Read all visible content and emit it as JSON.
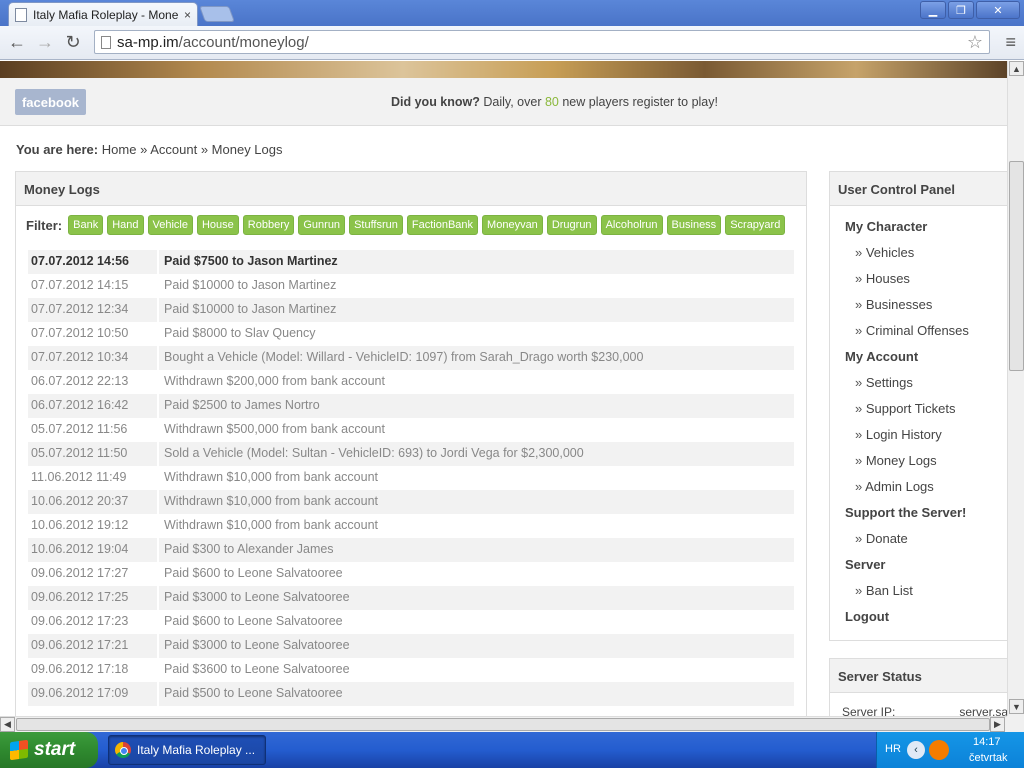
{
  "browser": {
    "tab_title": "Italy Mafia Roleplay - Money",
    "tab_close": "×",
    "url_host": "sa-mp.im",
    "url_path": "/account/moneylog/"
  },
  "page": {
    "facebook_label": "facebook",
    "did_you_know_label": "Did you know?",
    "did_you_know_pre": " Daily, over ",
    "did_you_know_num": "80",
    "did_you_know_post": " new players register to play!",
    "breadcrumb": {
      "label": "You are here:",
      "items": [
        "Home",
        "Account",
        "Money Logs"
      ],
      "sep": "»"
    },
    "main_title": "Money Logs",
    "filter_label": "Filter:",
    "filters": [
      "Bank",
      "Hand",
      "Vehicle",
      "House",
      "Robbery",
      "Gunrun",
      "Stuffsrun",
      "FactionBank",
      "Moneyvan",
      "Drugrun",
      "Alcoholrun",
      "Business",
      "Scrapyard"
    ],
    "logs": [
      {
        "date": "07.07.2012 14:56",
        "text": "Paid $7500 to Jason Martinez"
      },
      {
        "date": "07.07.2012 14:15",
        "text": "Paid $10000 to Jason Martinez"
      },
      {
        "date": "07.07.2012 12:34",
        "text": "Paid $10000 to Jason Martinez"
      },
      {
        "date": "07.07.2012 10:50",
        "text": "Paid $8000 to Slav Quency"
      },
      {
        "date": "07.07.2012 10:34",
        "text": "Bought a Vehicle (Model: Willard - VehicleID: 1097) from Sarah_Drago worth $230,000"
      },
      {
        "date": "06.07.2012 22:13",
        "text": "Withdrawn $200,000 from bank account"
      },
      {
        "date": "06.07.2012 16:42",
        "text": "Paid $2500 to James Nortro"
      },
      {
        "date": "05.07.2012 11:56",
        "text": "Withdrawn $500,000 from bank account"
      },
      {
        "date": "05.07.2012 11:50",
        "text": "Sold a Vehicle (Model: Sultan - VehicleID: 693) to Jordi Vega for $2,300,000"
      },
      {
        "date": "11.06.2012 11:49",
        "text": "Withdrawn $10,000 from bank account"
      },
      {
        "date": "10.06.2012 20:37",
        "text": "Withdrawn $10,000 from bank account"
      },
      {
        "date": "10.06.2012 19:12",
        "text": "Withdrawn $10,000 from bank account"
      },
      {
        "date": "10.06.2012 19:04",
        "text": "Paid $300 to Alexander James"
      },
      {
        "date": "09.06.2012 17:27",
        "text": "Paid $600 to Leone Salvatooree"
      },
      {
        "date": "09.06.2012 17:25",
        "text": "Paid $3000 to Leone Salvatooree"
      },
      {
        "date": "09.06.2012 17:23",
        "text": "Paid $600 to Leone Salvatooree"
      },
      {
        "date": "09.06.2012 17:21",
        "text": "Paid $3000 to Leone Salvatooree"
      },
      {
        "date": "09.06.2012 17:18",
        "text": "Paid $3600 to Leone Salvatooree"
      },
      {
        "date": "09.06.2012 17:09",
        "text": "Paid $500 to Leone Salvatooree"
      }
    ],
    "ucp_title": "User Control Panel",
    "ucp_items": [
      {
        "label": "My Character",
        "type": "sec"
      },
      {
        "label": "Vehicles",
        "type": "sub"
      },
      {
        "label": "Houses",
        "type": "sub"
      },
      {
        "label": "Businesses",
        "type": "sub"
      },
      {
        "label": "Criminal Offenses",
        "type": "sub"
      },
      {
        "label": "My Account",
        "type": "sec"
      },
      {
        "label": "Settings",
        "type": "sub"
      },
      {
        "label": "Support Tickets",
        "type": "sub"
      },
      {
        "label": "Login History",
        "type": "sub"
      },
      {
        "label": "Money Logs",
        "type": "sub"
      },
      {
        "label": "Admin Logs",
        "type": "sub"
      },
      {
        "label": "Support the Server!",
        "type": "sec"
      },
      {
        "label": "Donate",
        "type": "sub"
      },
      {
        "label": "Server",
        "type": "sec"
      },
      {
        "label": "Ban List",
        "type": "sub"
      },
      {
        "label": "Logout",
        "type": "sec"
      }
    ],
    "status_title": "Server Status",
    "status_ip_label": "Server IP:",
    "status_ip_value": "server.sa-"
  },
  "taskbar": {
    "start_label": "start",
    "task_title": "Italy Mafia Roleplay ...",
    "lang": "HR",
    "time": "14:17",
    "day": "četvrtak"
  }
}
